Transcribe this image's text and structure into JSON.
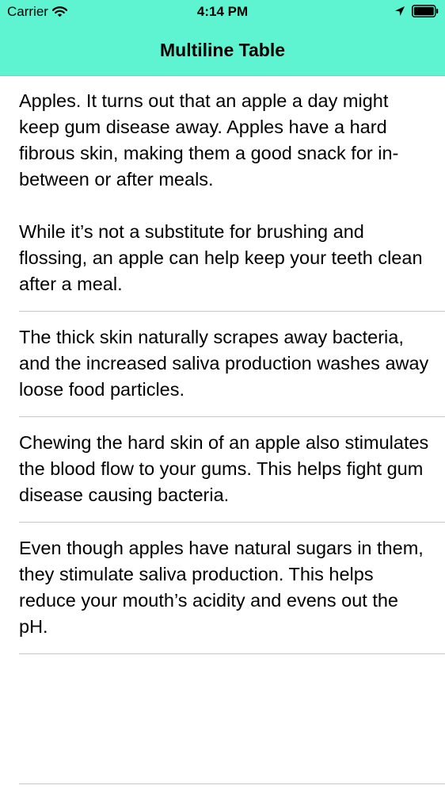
{
  "colors": {
    "header_background": "#5ef4d2",
    "separator": "#c8c7cc",
    "text": "#000000"
  },
  "status_bar": {
    "carrier": "Carrier",
    "time": "4:14 PM",
    "icons": [
      "wifi-icon",
      "location-arrow-icon",
      "battery-icon"
    ]
  },
  "nav_bar": {
    "title": "Multiline Table"
  },
  "table": {
    "rows": [
      {
        "text": "Apples. It turns out that an apple a day might keep gum disease away. Apples have a hard fibrous skin, making them a good snack for in-between or after meals.\n\nWhile it’s not a substitute for brushing and flossing, an apple can help keep your teeth clean after a meal."
      },
      {
        "text": "The thick skin naturally scrapes away bacteria, and the increased saliva production washes away loose food particles."
      },
      {
        "text": "Chewing the hard skin of an apple also stimulates the blood flow to your gums. This helps fight gum disease causing bacteria."
      },
      {
        "text": "Even though apples have natural sugars in them, they stimulate saliva production. This helps reduce your mouth’s acidity and evens out the pH."
      }
    ]
  }
}
